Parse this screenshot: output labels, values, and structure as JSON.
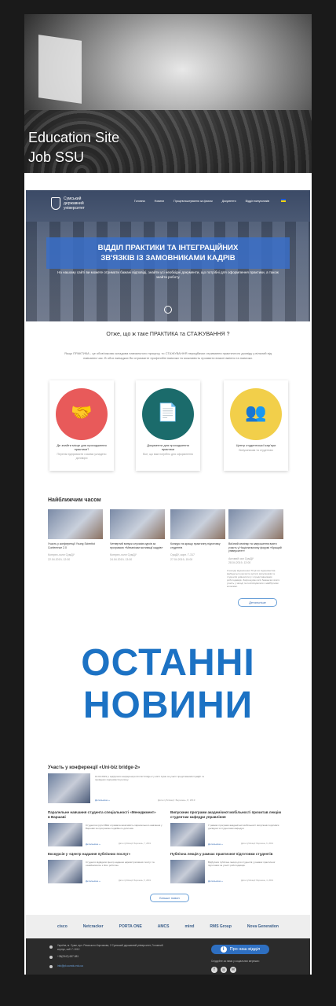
{
  "hero": {
    "line1": "Education Site",
    "line2": "Job SSU"
  },
  "site": {
    "logo": {
      "line1": "Сумський",
      "line2": "державний",
      "line3": "університет"
    },
    "nav": [
      "Головна",
      "Новини",
      "Працевлаштування за фахом",
      "Документи",
      "Відділ випускників"
    ],
    "banner_title_1": "ВІДДІЛ ПРАКТИКИ ТА ІНТЕГРАЦІЙНИХ",
    "banner_title_2": "ЗВ'ЯЗКІВ ІЗ ЗАМОВНИКАМИ КАДРІВ",
    "banner_sub": "На нашому сайті ви можете отримати бажані відповіді, знайти усі необхідні документи, що потрібні для оформлення практики, а також знайти роботу.",
    "question": "Отже, що ж таке ПРАКТИКА та СТАЖУВАННЯ ?",
    "question_text": "Якщо ПРАКТИКА - це обов'язкова складова навчального процесу, то СТАЖУВАННЯ передбачає отримання практичного досвіду у вільний від навчання час. В обох випадках Ви отримаєте професійні навички та можливість проявити власні вміння та навички.",
    "cards": [
      {
        "title": "Де знайти місце для проходження практики?",
        "sub": "Перелік підприємств з якими укладено договори"
      },
      {
        "title": "Документи для проходження практики",
        "sub": "Все, що вам потрібно для оформлення"
      },
      {
        "title": "Центр студентської кар'єри",
        "sub": "Випускникам та студентам"
      }
    ],
    "soon_title": "Найближчим часом",
    "events": [
      {
        "title": "Участь у конференції Young Scientist Conference 2.0",
        "meta": "Конгрес-холл СумДУ",
        "date": "22.04.2019, 12:00"
      },
      {
        "title": "Четвертий випуск слухачів курсів за програмою «Механізми мотивації кадрів»",
        "meta": "Конгрес-холл СумДУ",
        "date": "24.04.2019, 13:00"
      },
      {
        "title": "Конкурс на кращу практичну підготовку студентів",
        "meta": "СумДУ, корп. Г-317",
        "date": "27.04.2019, 15:00"
      },
      {
        "title": "Виїзний семінар та запрошення взяти участь у Національному форумі «Кращий університет»",
        "meta": "Актовий зал СумДУ",
        "date": "28.04.2019, 12:00"
      }
    ],
    "side_text": "З нагоди відзначення 70-річчя підприємства відбудеться урочиста зустріч випускників та студентів університету з представниками роботодавців. Запрошуємо всіх бажаючих взяти участь у заході та поспілкуватися з майбутніми колегами.",
    "all_events": "Детальніше",
    "big_1": "ОСТАННІ",
    "big_2": "НОВИНИ",
    "news": [
      {
        "title": "Участь у конференції «Uni-biz bridge-2»",
        "text": "16.02.2019 р. відбулася конференція Uni-biz bridge-2 у місті Суми за участі представників СумДУ та провідних підприємств регіону.",
        "more": "Детальніше »",
        "date": "Дата публікації: Березень, 8, 2019"
      },
      {
        "title": "Паралельне навчання студента спеціальності «Менеджмент» в Варшаві",
        "text": "Студентка групи МЕН отримала можливість паралельного навчання у Варшаві за програмою подвійного диплома.",
        "more": "Детальніше »",
        "date": "Дата публікації: Березень, 7, 2019"
      },
      {
        "title": "Випускник програми академічної мобільності прочитав лекцію студентам кафедри управління",
        "text": "У рамках програми академічної мобільності випускник поділився досвідом зі студентами кафедри.",
        "more": "Детальніше »",
        "date": "Дата публікації: Березень, 6, 2019"
      },
      {
        "title": "Екскурсія у «Центр надання публічних послуг»",
        "text": "Студенти відвідали Центр надання адміністративних послуг та ознайомились з його роботою.",
        "more": "Детальніше »",
        "date": "Дата публікації: Березень, 5, 2019"
      },
      {
        "title": "Публічна лекція у рамках практичної підготовки студентів",
        "text": "Відбулася публічна лекція для студентів у рамках практичної підготовки за участі роботодавців.",
        "more": "Детальніше »",
        "date": "Дата публікації: Березень, 4, 2019"
      }
    ],
    "more_news": "Більше новин",
    "partners": [
      "cisco",
      "Netcracker",
      "PORTA ONE",
      "AMCS",
      "mind",
      "RMS Group",
      "Nova Generation"
    ],
    "footer": {
      "address": "Україна, м. Суми, вул. Римського-Корсакова, 2 Сумський державний університет, Головний корпус, каб. Г-1012",
      "phone": "+38(0542) 687-881",
      "email": "info@pk.sumdu.edu.ua",
      "about": "Про наш відділ",
      "social_caption": "Слідкуйте за нами у соціальних мережах:"
    }
  }
}
